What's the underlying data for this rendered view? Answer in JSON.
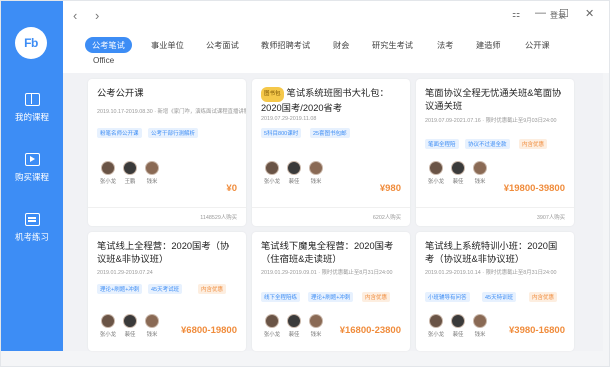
{
  "sidebar": {
    "logo": "Fb",
    "items": [
      {
        "label": "我的课程",
        "icon": "book-icon"
      },
      {
        "label": "购买课程",
        "icon": "play-icon"
      },
      {
        "label": "机考练习",
        "icon": "exam-icon"
      }
    ]
  },
  "titlebar": {
    "back": "‹",
    "forward": "›",
    "login": "登录",
    "window_controls": [
      "⚏",
      "—",
      "☐",
      "✕"
    ]
  },
  "tabs": [
    "公考笔试",
    "事业单位",
    "公考面试",
    "教师招聘考试",
    "财会",
    "研究生考试",
    "法考",
    "建造师",
    "公开课",
    "Office"
  ],
  "cards": [
    {
      "title": "公考公开课",
      "date": "2019.10.17-2019.08.30 · 新增《家门咋，演练面试课程直播讲解》",
      "tags": [
        {
          "text": "粉笔名师公开课",
          "color": "blue"
        },
        {
          "text": "公考干部行测解析",
          "color": "blue"
        }
      ],
      "teachers": [
        "张小龙",
        "王鹏",
        "钱米"
      ],
      "price": "¥0",
      "sales": "1148529人购买"
    },
    {
      "title": "笔试系统班图书大礼包：2020国考/2020省考",
      "badge": "图书包",
      "date": "2019.07.29-2019.11.08",
      "tags": [
        {
          "text": "5科目800课时",
          "color": "blue"
        },
        {
          "text": "25套图书包邮",
          "color": "blue"
        }
      ],
      "teachers": [
        "张小龙",
        "裴佳",
        "钱米"
      ],
      "price": "¥980",
      "sales": "6202人购买"
    },
    {
      "title": "笔面协议全程无忧通关班&笔面协议通关班",
      "date": "2019.07.09-2021.07.16 · 限时优惠截止至9月03日24:00",
      "tags": [
        {
          "text": "笔面全程陪",
          "color": "blue"
        },
        {
          "text": "协议不过退全款",
          "color": "blue"
        },
        {
          "text": "内含优惠",
          "color": "orange"
        }
      ],
      "teachers": [
        "张小龙",
        "裴佳",
        "钱米"
      ],
      "price": "¥19800-39800",
      "sales": "3907人购买"
    },
    {
      "title": "笔试线上全程营：2020国考（协议班&非协议班）",
      "date": "2019.01.29-2019.07.24",
      "tags": [
        {
          "text": "理论+刷题+冲刺",
          "color": "blue"
        },
        {
          "text": "45天考试班",
          "color": "blue"
        },
        {
          "text": "内含优惠",
          "color": "orange"
        }
      ],
      "teachers": [
        "张小龙",
        "裴佳",
        "钱米"
      ],
      "price": "¥6800-19800",
      "sales": ""
    },
    {
      "title": "笔试线下魔鬼全程营：2020国考（住宿班&走读班）",
      "date": "2019.01.29-2019.09.01 · 限时优惠截止至8月31日24:00",
      "tags": [
        {
          "text": "线下全程陪练",
          "color": "blue"
        },
        {
          "text": "理论+刷题+冲刺",
          "color": "blue"
        },
        {
          "text": "内含优惠",
          "color": "orange"
        }
      ],
      "teachers": [
        "张小龙",
        "裴佳",
        "钱米"
      ],
      "price": "¥16800-23800",
      "sales": ""
    },
    {
      "title": "笔试线上系统特训小班：2020国考（协议班&非协议班）",
      "date": "2019.01.29-2019.10.14 · 限时优惠截止至8月31日24:00",
      "tags": [
        {
          "text": "小班辅导有问答",
          "color": "blue"
        },
        {
          "text": "45天特训班",
          "color": "blue"
        },
        {
          "text": "内含优惠",
          "color": "orange"
        }
      ],
      "teachers": [
        "张小龙",
        "裴佳",
        "钱米"
      ],
      "price": "¥3980-16800",
      "sales": ""
    }
  ]
}
